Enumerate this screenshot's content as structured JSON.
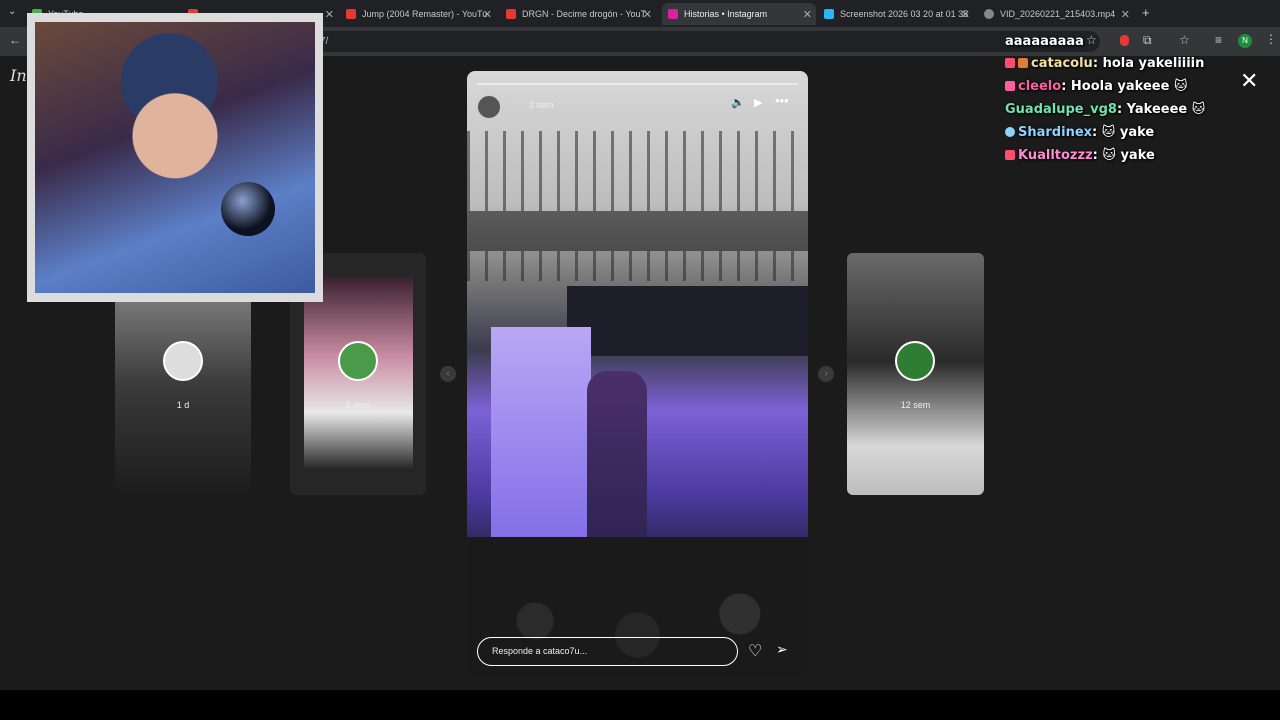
{
  "tabs": [
    {
      "title": "YouTube"
    },
    {
      "title": ""
    },
    {
      "title": "Jump (2004 Remaster) - YouTu"
    },
    {
      "title": "DRGN - Decime drogón - YouT"
    },
    {
      "title": "Historias • Instagram"
    },
    {
      "title": "Screenshot 2026 03 20 at 01 35"
    },
    {
      "title": "VID_20260221_215403.mp4"
    }
  ],
  "address": {
    "url_tail": "7/"
  },
  "instagram": {
    "logo_text": "In",
    "main_story": {
      "age": "2 sem",
      "reply_placeholder": "Responde a cataco7u..."
    },
    "side_stories": [
      {
        "age": "1 d"
      },
      {
        "age": "2 sem"
      },
      {
        "age": "12 sem"
      }
    ],
    "close": "✕"
  },
  "chat": {
    "top_cut": "aaaaaaaaa",
    "messages": [
      {
        "user": "catacolu",
        "user_color": "#f5e0a0",
        "text": "hola yakeliiiin"
      },
      {
        "user": "cleelo",
        "user_color": "#ff5fa0",
        "text": "Hoola yakeee 🐱"
      },
      {
        "user": "Guadalupe_vg8",
        "user_color": "#6fe3b0",
        "text": "Yakeeee 🐱"
      },
      {
        "user": "Shardinex",
        "user_color": "#8fd1ff",
        "text": "🐱 yake"
      },
      {
        "user": "Kualltozzz",
        "user_color": "#ff8ad0",
        "text": "🐱 yake"
      }
    ]
  }
}
